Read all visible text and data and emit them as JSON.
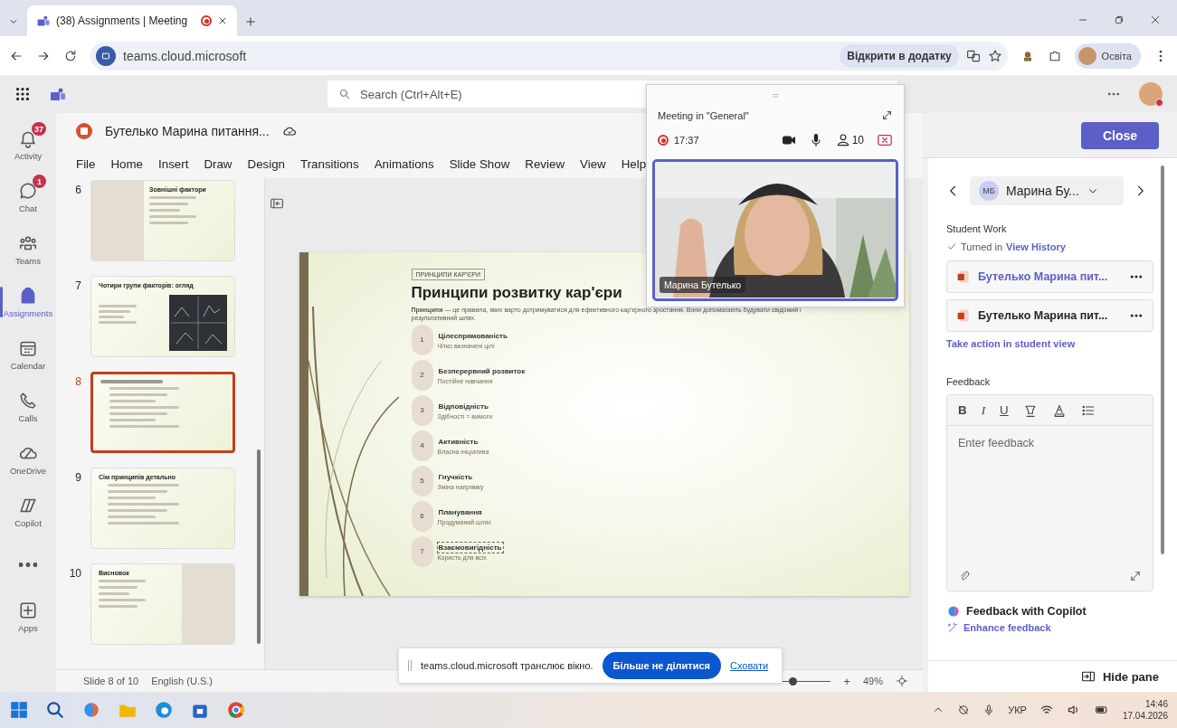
{
  "browser": {
    "tabs": [
      {
        "title": "(38) Assignments | Meeting",
        "selected": true
      }
    ],
    "address": "teams.cloud.microsoft",
    "open_in_app": "Відкрити в додатку",
    "profile": "Освіта"
  },
  "teams_header": {
    "search_placeholder": "Search (Ctrl+Alt+E)"
  },
  "rail": [
    {
      "label": "Activity",
      "kind": "bell",
      "badge": "37",
      "selected": false
    },
    {
      "label": "Chat",
      "kind": "chat",
      "badge": "1",
      "selected": false
    },
    {
      "label": "Teams",
      "kind": "teams",
      "selected": false
    },
    {
      "label": "Assignments",
      "kind": "bag",
      "selected": true
    },
    {
      "label": "Calendar",
      "kind": "calendar",
      "selected": false
    },
    {
      "label": "Calls",
      "kind": "phone",
      "selected": false
    },
    {
      "label": "OneDrive",
      "kind": "cloud",
      "selected": false
    },
    {
      "label": "Copilot",
      "kind": "copilot",
      "selected": false
    },
    {
      "kind": "dots",
      "selected": false
    },
    {
      "label": "Apps",
      "kind": "plus",
      "selected": false
    }
  ],
  "ppt": {
    "file_title": "Бутелько Марина питання...",
    "ribbon": [
      "File",
      "Home",
      "Insert",
      "Draw",
      "Design",
      "Transitions",
      "Animations",
      "Slide Show",
      "Review",
      "View",
      "Help"
    ],
    "thumbnails": [
      {
        "number": "6",
        "title": "Зовнішні фактори",
        "kind": "split",
        "selected": false
      },
      {
        "number": "7",
        "title": "Чотири групи факторів: огляд",
        "kind": "grid",
        "selected": false
      },
      {
        "number": "8",
        "kind": "list",
        "selected": true
      },
      {
        "number": "9",
        "title": "Сім принципів детально",
        "kind": "list",
        "selected": false
      },
      {
        "number": "10",
        "title": "Висновок",
        "kind": "split",
        "selected": false
      }
    ],
    "slide": {
      "tag": "ПРИНЦИПИ КАР'ЄРИ",
      "title": "Принципи розвитку кар'єри",
      "intro": "**Принципи** — це правила, яких варто дотримуватися для ефективного кар'єрного зростання. Вони допомагають будувати свідомий і результативний шлях.",
      "items": [
        {
          "number": "1",
          "title": "Цілеспрямованість",
          "subtitle": "Чітко визначені цілі"
        },
        {
          "number": "2",
          "title": "Безперервний розвиток",
          "subtitle": "Постійне навчання"
        },
        {
          "number": "3",
          "title": "Відповідність",
          "subtitle": "Здібності = вимоги"
        },
        {
          "number": "4",
          "title": "Активність",
          "subtitle": "Власна ініціатива"
        },
        {
          "number": "5",
          "title": "Гнучкість",
          "subtitle": "Зміна напрямку"
        },
        {
          "number": "6",
          "title": "Планування",
          "subtitle": "Продуманий шлях"
        },
        {
          "number": "7",
          "title": "Взаємовигідність",
          "subtitle": "Користь для всіх",
          "selected": true
        }
      ]
    },
    "status_bar": {
      "slide_info": "Slide 8 of 10",
      "language": "English (U.S.)",
      "zoom_slider": {
        "level": 0.4
      },
      "zoom_in": "+",
      "zoom": "49%"
    }
  },
  "meeting": {
    "title": "Meeting in \"General\"",
    "duration": "17:37",
    "participants": "10",
    "video": {
      "kind": "picture",
      "name": "Марина Бутелько"
    }
  },
  "pane": {
    "close": "Close",
    "student": {
      "initials": "МБ",
      "name": "Марина Бу..."
    },
    "student_work_label": "Student Work",
    "status": "Turned in",
    "history_link": "View History",
    "files": [
      {
        "name": "Бутелько Марина пит...",
        "open": true
      },
      {
        "name": "Бутелько Марина пит...",
        "open": false
      }
    ],
    "action_link": "Take action in student view",
    "feedback_label": "Feedback",
    "format_buttons": [
      "B",
      "I",
      "U"
    ],
    "feedback_placeholder": "Enter feedback",
    "copilot_title": "Feedback with Copilot",
    "enhance": "Enhance feedback",
    "hide_pane": "Hide pane"
  },
  "share_bar": {
    "message": "teams.cloud.microsoft транслює вікно.",
    "stop": "Більше не ділитися",
    "hide": "Сховати"
  },
  "taskbar": {
    "language": "УКР",
    "time": "14:46",
    "date": "17.04.2026"
  }
}
